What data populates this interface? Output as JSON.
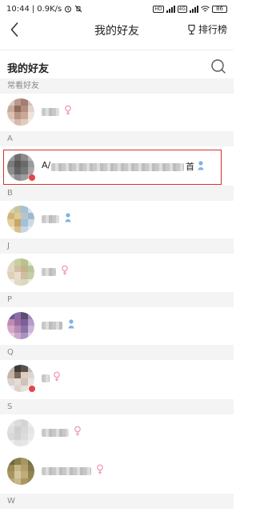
{
  "status_bar": {
    "time": "10:44",
    "speed": "0.9K/s",
    "network_tag_1": "HD",
    "network_tag_2": "4G",
    "battery": "86"
  },
  "nav": {
    "title": "我的好友",
    "rank_label": "排行榜"
  },
  "section": {
    "title": "我的好友"
  },
  "groups": {
    "frequent": "常看好友",
    "a": "A",
    "b": "B",
    "j": "J",
    "p": "P",
    "q": "Q",
    "s": "S",
    "w": "W"
  },
  "highlighted_row": {
    "prefix": "A/",
    "suffix": "首"
  },
  "colors": {
    "female": "#f19bb8",
    "male": "#7fb2e5",
    "highlight": "#d32f2f"
  }
}
